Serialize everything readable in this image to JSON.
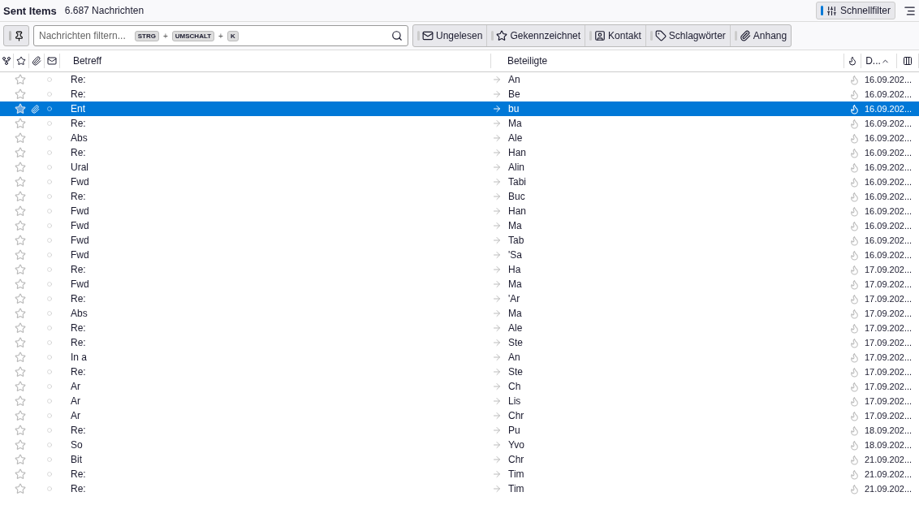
{
  "header": {
    "folder": "Sent Items",
    "count": "6.687 Nachrichten",
    "quick_filter": "Schnellfilter"
  },
  "filter": {
    "placeholder": "Nachrichten filtern...",
    "keys": [
      "STRG",
      "+",
      "UMSCHALT",
      "+",
      "K"
    ]
  },
  "filter_buttons": [
    {
      "kind": "unread",
      "label": "Ungelesen"
    },
    {
      "kind": "starred",
      "label": "Gekennzeichnet"
    },
    {
      "kind": "contact",
      "label": "Kontakt"
    },
    {
      "kind": "tags",
      "label": "Schlagwörter"
    },
    {
      "kind": "attachment",
      "label": "Anhang"
    }
  ],
  "columns": {
    "subject": "Betreff",
    "correspondents": "Beteiligte",
    "date": "D..."
  },
  "rows": [
    {
      "subject": "Re:",
      "correspondent": "An",
      "date": "16.09.202...",
      "selected": false,
      "attachment": false
    },
    {
      "subject": "Re:",
      "correspondent": "Be",
      "date": "16.09.202...",
      "selected": false,
      "attachment": false
    },
    {
      "subject": "Ent",
      "correspondent": "bu",
      "date": "16.09.202...",
      "selected": true,
      "attachment": true
    },
    {
      "subject": "Re:",
      "correspondent": "Ma",
      "date": "16.09.202...",
      "selected": false,
      "attachment": false
    },
    {
      "subject": "Abs",
      "correspondent": "Ale",
      "date": "16.09.202...",
      "selected": false,
      "attachment": false
    },
    {
      "subject": "Re:",
      "correspondent": "Han",
      "date": "16.09.202...",
      "selected": false,
      "attachment": false
    },
    {
      "subject": "Ural",
      "correspondent": "Alin",
      "date": "16.09.202...",
      "selected": false,
      "attachment": false
    },
    {
      "subject": "Fwd",
      "correspondent": "Tabi",
      "date": "16.09.202...",
      "selected": false,
      "attachment": false
    },
    {
      "subject": "Re:",
      "correspondent": "Buc",
      "date": "16.09.202...",
      "selected": false,
      "attachment": false
    },
    {
      "subject": "Fwd",
      "correspondent": "Han",
      "date": "16.09.202...",
      "selected": false,
      "attachment": false
    },
    {
      "subject": "Fwd",
      "correspondent": "Ma",
      "date": "16.09.202...",
      "selected": false,
      "attachment": false
    },
    {
      "subject": "Fwd",
      "correspondent": "Tab",
      "date": "16.09.202...",
      "selected": false,
      "attachment": false
    },
    {
      "subject": "Fwd",
      "correspondent": "'Sa",
      "date": "16.09.202...",
      "selected": false,
      "attachment": false
    },
    {
      "subject": "Re:",
      "correspondent": "Ha",
      "date": "17.09.202...",
      "selected": false,
      "attachment": false
    },
    {
      "subject": "Fwd",
      "correspondent": "Ma",
      "date": "17.09.202...",
      "selected": false,
      "attachment": false
    },
    {
      "subject": "Re:",
      "correspondent": "'Ar",
      "date": "17.09.202...",
      "selected": false,
      "attachment": false
    },
    {
      "subject": "Abs",
      "correspondent": "Ma",
      "date": "17.09.202...",
      "selected": false,
      "attachment": false
    },
    {
      "subject": "Re:",
      "correspondent": "Ale",
      "date": "17.09.202...",
      "selected": false,
      "attachment": false
    },
    {
      "subject": "Re:",
      "correspondent": "Ste",
      "date": "17.09.202...",
      "selected": false,
      "attachment": false
    },
    {
      "subject": "In a",
      "correspondent": "An",
      "date": "17.09.202...",
      "selected": false,
      "attachment": false
    },
    {
      "subject": "Re:",
      "correspondent": "Ste",
      "date": "17.09.202...",
      "selected": false,
      "attachment": false
    },
    {
      "subject": "Ar",
      "correspondent": "Ch",
      "date": "17.09.202...",
      "selected": false,
      "attachment": false
    },
    {
      "subject": "Ar",
      "correspondent": "Lis",
      "date": "17.09.202...",
      "selected": false,
      "attachment": false
    },
    {
      "subject": "Ar",
      "correspondent": "Chr",
      "date": "17.09.202...",
      "selected": false,
      "attachment": false
    },
    {
      "subject": "Re:",
      "correspondent": "Pu",
      "date": "18.09.202...",
      "selected": false,
      "attachment": false
    },
    {
      "subject": "So",
      "correspondent": "Yvo",
      "date": "18.09.202...",
      "selected": false,
      "attachment": false
    },
    {
      "subject": "Bit",
      "correspondent": "Chr",
      "date": "21.09.202...",
      "selected": false,
      "attachment": false
    },
    {
      "subject": "Re:",
      "correspondent": "Tim",
      "date": "21.09.202...",
      "selected": false,
      "attachment": false
    },
    {
      "subject": "Re:",
      "correspondent": "Tim",
      "date": "21.09.202...",
      "selected": false,
      "attachment": false
    }
  ]
}
